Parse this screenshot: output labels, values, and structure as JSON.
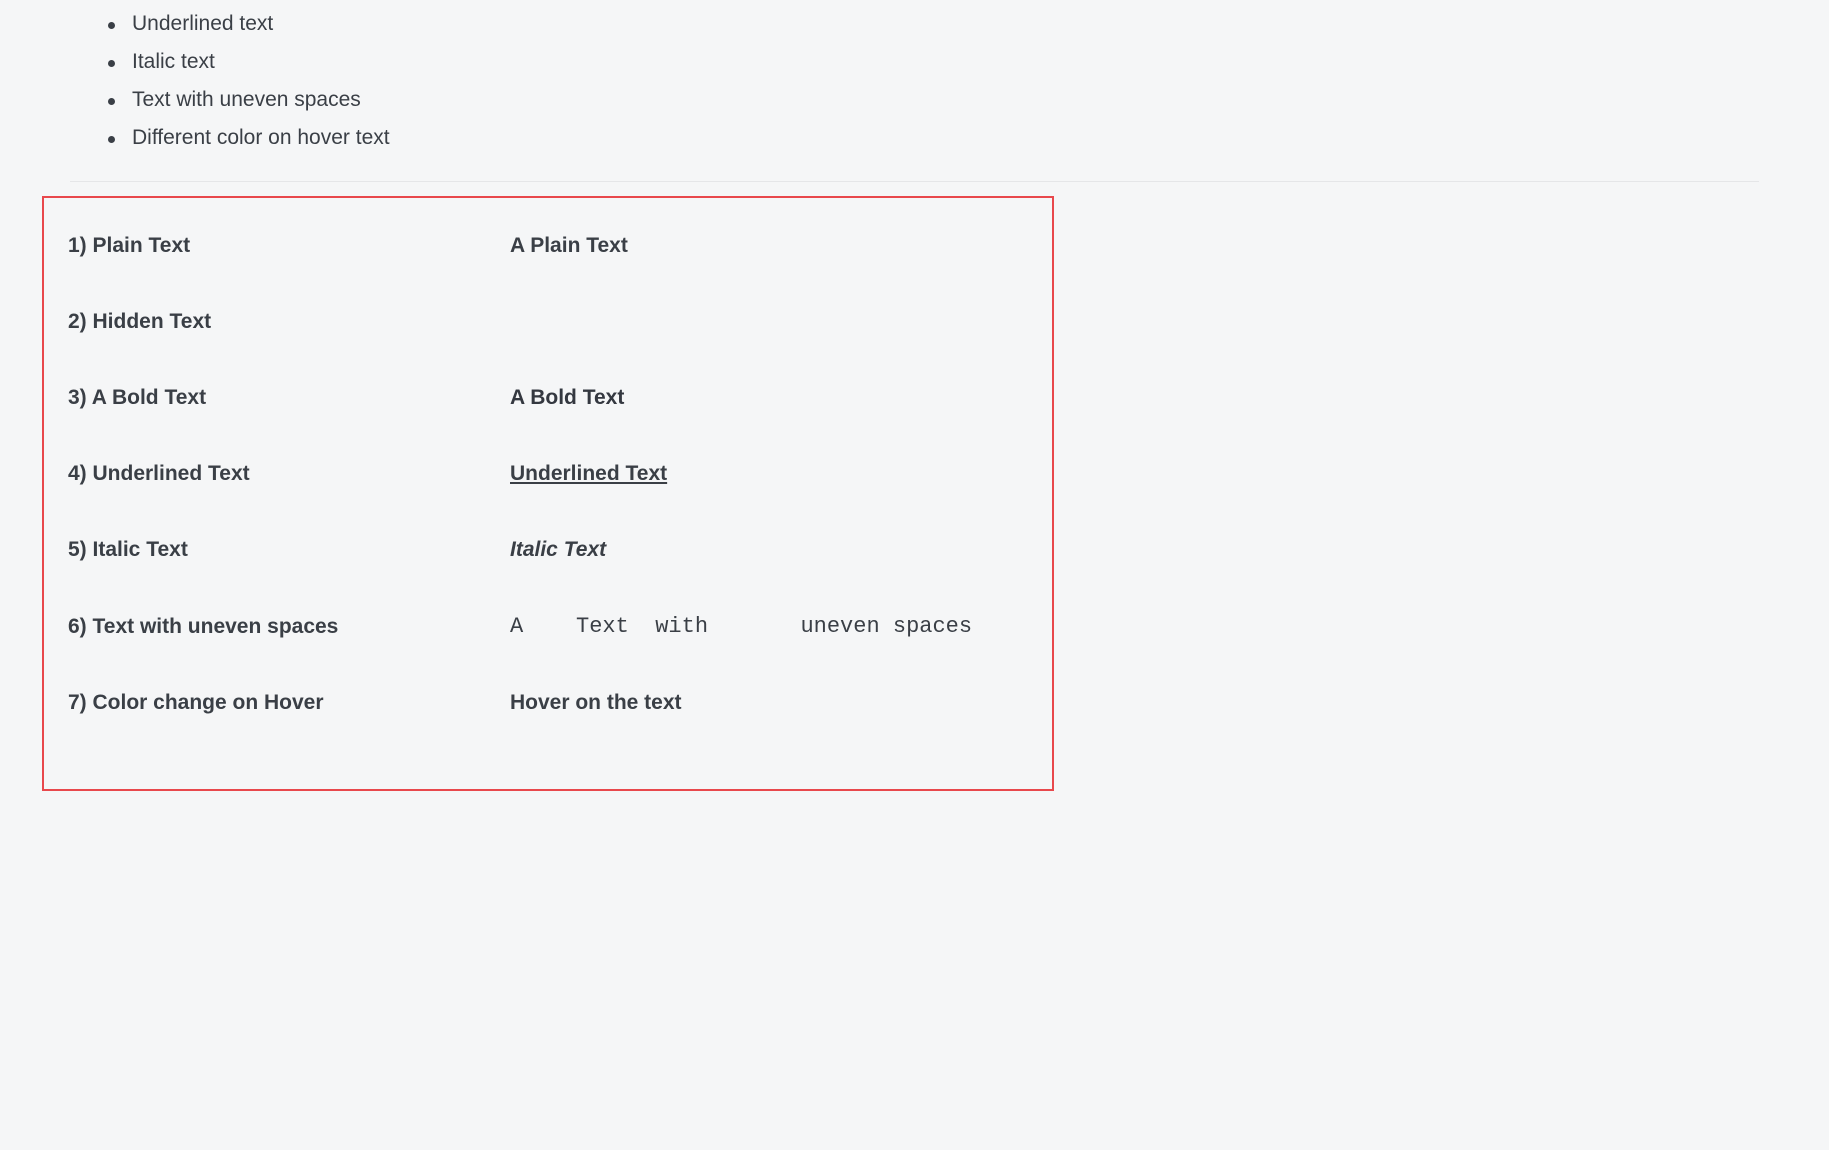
{
  "bullets": [
    "Underlined text",
    "Italic text",
    "Text with uneven spaces",
    "Different color on hover text"
  ],
  "rows": {
    "plain": {
      "label": "1) Plain Text",
      "value": "A Plain Text"
    },
    "hidden": {
      "label": "2) Hidden Text",
      "value": ""
    },
    "bold": {
      "label": "3) A Bold Text",
      "value": "A Bold Text"
    },
    "underlined": {
      "label": "4) Underlined Text",
      "value": "Underlined Text"
    },
    "italic": {
      "label": "5) Italic Text",
      "value": "Italic Text"
    },
    "uneven": {
      "label": "6) Text with uneven spaces",
      "value": "A    Text  with       uneven spaces"
    },
    "hover": {
      "label": "7) Color change on Hover",
      "value": "Hover on the text"
    }
  }
}
